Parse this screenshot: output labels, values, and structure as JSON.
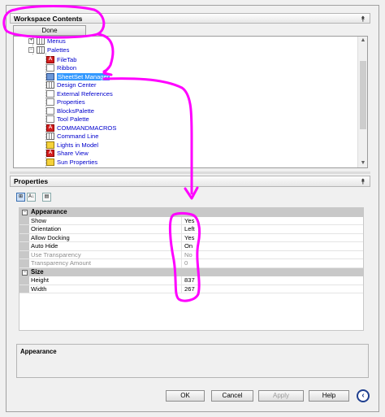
{
  "workspace": {
    "header": "Workspace Contents",
    "collapse_glyph": "⯭",
    "done_label": "Done",
    "tree": [
      {
        "label": "Menus",
        "icon": "menus-icon"
      },
      {
        "label": "Palettes",
        "icon": "palettes-icon"
      },
      {
        "label": "FileTab",
        "icon": "autocad-a-icon"
      },
      {
        "label": "Ribbon",
        "icon": "ribbon-icon"
      },
      {
        "label": "SheetSet Manager",
        "icon": "sheetset-icon",
        "selected": true
      },
      {
        "label": "Design Center",
        "icon": "design-center-icon"
      },
      {
        "label": "External References",
        "icon": "xref-icon"
      },
      {
        "label": "Properties",
        "icon": "properties-icon"
      },
      {
        "label": "BlocksPalette",
        "icon": "blocks-icon"
      },
      {
        "label": "Tool Palette",
        "icon": "tool-palette-icon"
      },
      {
        "label": "COMMANDMACROS",
        "icon": "autocad-a-icon"
      },
      {
        "label": "Command Line",
        "icon": "command-line-icon"
      },
      {
        "label": "Lights in Model",
        "icon": "lights-icon"
      },
      {
        "label": "Share View",
        "icon": "autocad-a-icon"
      },
      {
        "label": "Sun Properties",
        "icon": "sun-icon"
      }
    ]
  },
  "properties": {
    "header": "Properties",
    "collapse_glyph": "⯭",
    "toolbar": [
      {
        "icon": "categorized-icon",
        "glyph": "⊞",
        "active": true
      },
      {
        "icon": "alphabetical-icon",
        "glyph": "A↓",
        "active": false
      },
      {
        "icon": "property-pages-icon",
        "glyph": "▤",
        "active": false
      }
    ],
    "categories": [
      {
        "name": "Appearance",
        "rows": [
          {
            "name": "Show",
            "value": "Yes",
            "disabled": false
          },
          {
            "name": "Orientation",
            "value": "Left",
            "disabled": false
          },
          {
            "name": "Allow Docking",
            "value": "Yes",
            "disabled": false
          },
          {
            "name": "Auto Hide",
            "value": "On",
            "disabled": false
          },
          {
            "name": "Use Transparency",
            "value": "No",
            "disabled": true
          },
          {
            "name": "Transparency Amount",
            "value": "0",
            "disabled": true
          }
        ]
      },
      {
        "name": "Size",
        "rows": [
          {
            "name": "Height",
            "value": "837",
            "disabled": false
          },
          {
            "name": "Width",
            "value": "267",
            "disabled": false
          }
        ]
      }
    ],
    "description_title": "Appearance"
  },
  "buttons": {
    "ok": "OK",
    "cancel": "Cancel",
    "apply": "Apply",
    "help": "Help"
  },
  "annotation_color": "#ff00ff"
}
